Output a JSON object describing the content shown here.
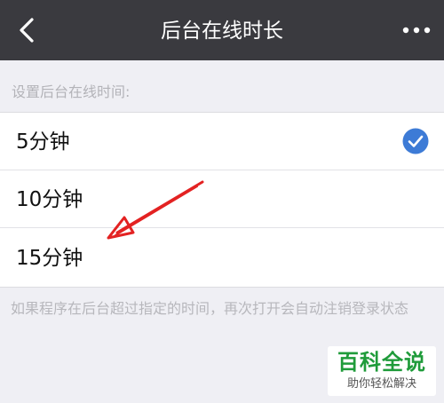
{
  "nav": {
    "title": "后台在线时长",
    "back_icon": "chevron-left-icon",
    "more_icon": "more-dots-icon"
  },
  "section_label": "设置后台在线时间:",
  "options": [
    {
      "label": "5分钟",
      "selected": true
    },
    {
      "label": "10分钟",
      "selected": false
    },
    {
      "label": "15分钟",
      "selected": false
    }
  ],
  "hint": "如果程序在后台超过指定的时间，再次打开会自动注销登录状态",
  "watermark": {
    "title": "百科全说",
    "subtitle": "助你轻松解决"
  },
  "colors": {
    "nav_bg": "#3a3a3f",
    "check_blue": "#3d7bd6",
    "annotation_red": "#e32222",
    "watermark_green": "#1f9b3a"
  }
}
